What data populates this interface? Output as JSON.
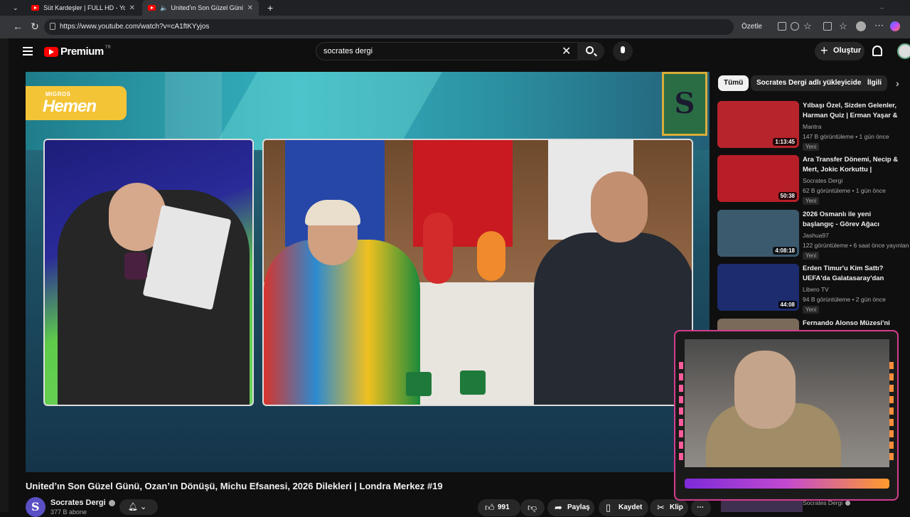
{
  "browser": {
    "tabs": [
      {
        "title": "Süt Kardeşler | FULL HD - YouTube"
      },
      {
        "title": "United'ın Son Güzel Günü, Oz"
      }
    ],
    "url": "https://www.youtube.com/watch?v=cA1ftKYyjos",
    "summarize_label": "Özetle"
  },
  "youtube": {
    "logo_word": "Premium",
    "logo_region": "TR",
    "search_value": "socrates dergi",
    "create_label": "Oluştur"
  },
  "video": {
    "brand_small": "MIGROS",
    "brand_big": "Hemen",
    "banner_letter": "S",
    "title": "United’ın Son Güzel Günü, Ozan’ın Dönüşü, Michu Efsanesi, 2026 Dilekleri | Londra Merkez #19",
    "channel": "Socrates Dergi",
    "subscribers": "377 B abone",
    "likes": "991",
    "share_label": "Paylaş",
    "save_label": "Kaydet",
    "clip_label": "Klip"
  },
  "chips": [
    "Tümü",
    "Socrates Dergi adlı yükleyiciden",
    "İlgili"
  ],
  "recommendations": [
    {
      "title": "Yılbaşı Özel, Sizden Gelenler, Harman Quiz | Erman Yaşar & ...",
      "channel": "Mantra",
      "meta": "147 B görüntüleme • 1 gün önce",
      "badge": "Yeni",
      "duration": "1:13:45",
      "thumb_color": "#b8242c"
    },
    {
      "title": "Ara Transfer Dönemi, Necip & Mert, Jokic Korkuttu | Mehmet...",
      "channel": "Socrates Dergi",
      "meta": "62 B görüntüleme • 1 gün önce",
      "badge": "Yeni",
      "duration": "50:38",
      "thumb_color": "#b81e28"
    },
    {
      "title": "2026 Osmanlı ile yeni başlangıç - Görev Ağacı tamamlamaca",
      "channel": "Jashua97",
      "meta": "122 görüntüleme • 6 saat önce yayınlandı",
      "badge": "Yeni",
      "duration": "4:08:18",
      "thumb_color": "#3c5a6e"
    },
    {
      "title": "Erden Timur'u Kim Sattı? UEFA'da Galatasaray'dan Daha...",
      "channel": "Libero TV",
      "meta": "94 B görüntüleme • 2 gün önce",
      "badge": "Yeni",
      "duration": "44:08",
      "thumb_color": "#1c2c6e"
    },
    {
      "title": "Fernando Alonso Müzesi'ni Gezelim!",
      "channel": "",
      "meta": "",
      "badge": "",
      "duration": "",
      "thumb_color": "#7a6a5a"
    }
  ],
  "bottom_rec": {
    "channel": "Socrates Dergi"
  }
}
